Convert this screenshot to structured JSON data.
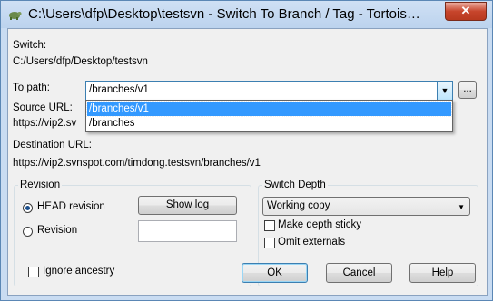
{
  "window": {
    "title": "C:\\Users\\dfp\\Desktop\\testsvn - Switch To Branch / Tag - Tortois…",
    "close_glyph": "✕"
  },
  "switch": {
    "label": "Switch:",
    "value": "C:/Users/dfp/Desktop/testsvn"
  },
  "to_path": {
    "label": "To path:",
    "value": "/branches/v1",
    "browse_label": "...",
    "options": [
      "/branches/v1",
      "/branches"
    ]
  },
  "source_url": {
    "label": "Source URL:",
    "value": "https://vip2.sv"
  },
  "destination_url": {
    "label": "Destination URL:",
    "value": "https://vip2.svnspot.com/timdong.testsvn/branches/v1"
  },
  "revision": {
    "group_label": "Revision",
    "head_label": "HEAD revision",
    "revision_label": "Revision",
    "show_log_label": "Show log",
    "revision_value": ""
  },
  "switch_depth": {
    "group_label": "Switch Depth",
    "selected": "Working copy",
    "make_sticky_label": "Make depth sticky",
    "omit_externals_label": "Omit externals"
  },
  "ignore_ancestry_label": "Ignore ancestry",
  "buttons": {
    "ok": "OK",
    "cancel": "Cancel",
    "help": "Help"
  },
  "colors": {
    "accent": "#3399ff",
    "titlebar": "#c9dcf2",
    "close": "#c7452c"
  }
}
